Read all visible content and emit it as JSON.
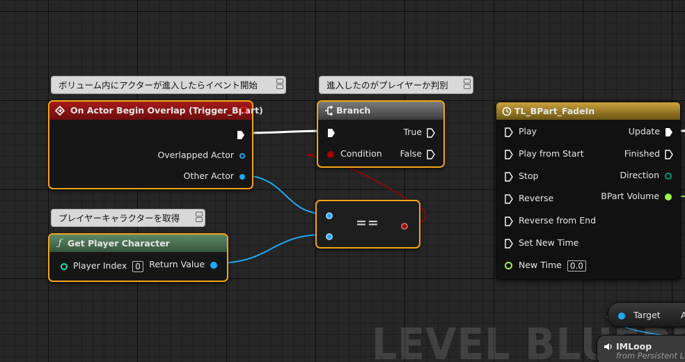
{
  "comments": {
    "overlap": "ボリューム内にアクターが進入したらイベント開始",
    "branch": "進入したのがプレイヤーか判別",
    "player": "プレイヤーキャラクターを取得"
  },
  "overlap_node": {
    "title": "On Actor Begin Overlap (Trigger_Bpart)",
    "overlapped_actor": "Overlapped Actor",
    "other_actor": "Other Actor"
  },
  "branch_node": {
    "title": "Branch",
    "true_label": "True",
    "condition_label": "Condition",
    "false_label": "False"
  },
  "equal_node": {
    "operator": "=="
  },
  "get_player_node": {
    "title": "Get Player Character",
    "player_index_label": "Player Index",
    "player_index_value": "0",
    "return_value_label": "Return Value"
  },
  "timeline_node": {
    "title": "TL_BPart_FadeIn",
    "inputs": [
      "Play",
      "Play from Start",
      "Stop",
      "Reverse",
      "Reverse from End",
      "Set New Time"
    ],
    "new_time_label": "New Time",
    "new_time_value": "0.0",
    "update": "Update",
    "finished": "Finished",
    "direction": "Direction",
    "bpart_volume": "BPart Volume"
  },
  "target_node": {
    "target": "Target",
    "extra": "A"
  },
  "imloop_node": {
    "title": "IMLoop",
    "subtitle": "from Persistent Le"
  },
  "watermark": "LEVEL BLUEPRINT",
  "colors": {
    "selection": "#f5a415",
    "object_pin": "#1fa9f5",
    "bool_pin": "#a20000",
    "float_pin": "#9df34d",
    "struct_pin": "#009a8c",
    "int_pin": "#1fe2ad",
    "event_header": "#8d1212",
    "function_header": "#4a7050",
    "timeline_header": "#a3862a"
  }
}
